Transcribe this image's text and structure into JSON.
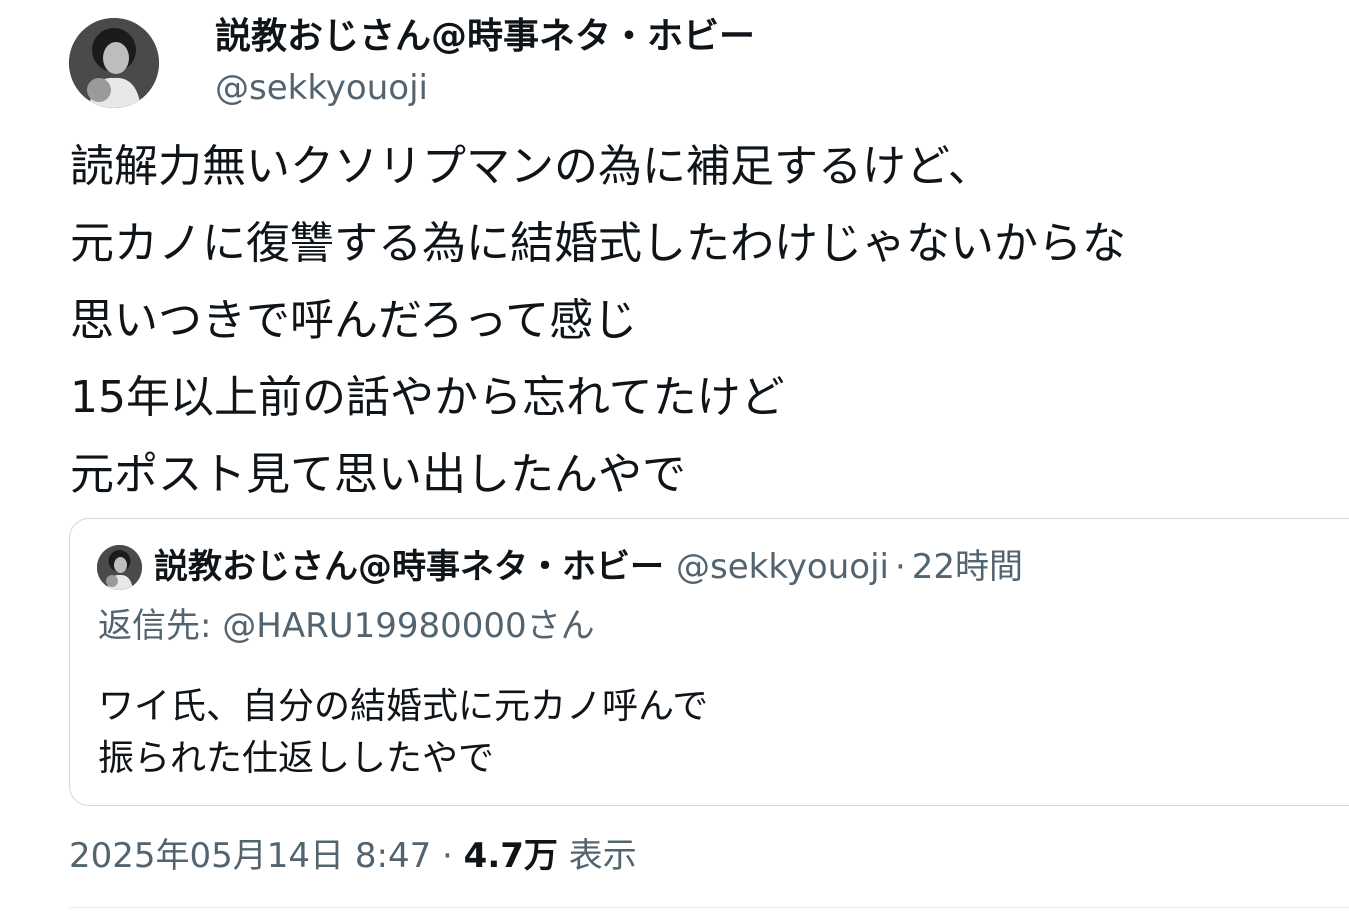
{
  "author": {
    "name": "説教おじさん@時事ネタ・ホビー",
    "handle": "@sekkyouoji",
    "avatar_icon": "user-avatar-icon"
  },
  "tweet": {
    "lines": [
      "読解力無いクソリプマンの為に補足するけど、",
      "元カノに復讐する為に結婚式したわけじゃないからな",
      "思いつきで呼んだろって感じ",
      "15年以上前の話やから忘れてたけど",
      "元ポスト見て思い出したんやで"
    ]
  },
  "quote": {
    "name": "説教おじさん@時事ネタ・ホビー",
    "handle": "@sekkyouoji",
    "separator": "·",
    "time": "22時間",
    "reply_label": "返信先: ",
    "reply_handle": "@HARU19980000さん",
    "lines": [
      "ワイ氏、自分の結婚式に元カノ呼んで",
      "振られた仕返ししたやで"
    ]
  },
  "meta": {
    "timestamp": "2025年05月14日 8:47",
    "separator": "·",
    "views_count": "4.7万",
    "views_label": "表示"
  },
  "colors": {
    "text_primary": "#0f1419",
    "text_secondary": "#536471",
    "border": "#cfd9de"
  }
}
